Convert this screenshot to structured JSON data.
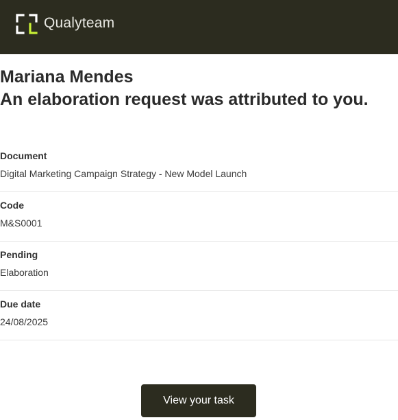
{
  "brand": {
    "name": "Qualyteam",
    "logo_icon": "qualyteam-bracket-logo",
    "colors": {
      "header_bg": "#2c2c1f",
      "accent": "#c7f035",
      "logo_mark": "#ffffff"
    }
  },
  "message": {
    "recipient": "Mariana Mendes",
    "headline": "An elaboration request was attributed to you."
  },
  "fields": [
    {
      "label": "Document",
      "value": "Digital Marketing Campaign Strategy - New Model Launch"
    },
    {
      "label": "Code",
      "value": "M&S0001"
    },
    {
      "label": "Pending",
      "value": "Elaboration"
    },
    {
      "label": "Due date",
      "value": "24/08/2025"
    }
  ],
  "cta": {
    "label": "View your task"
  }
}
